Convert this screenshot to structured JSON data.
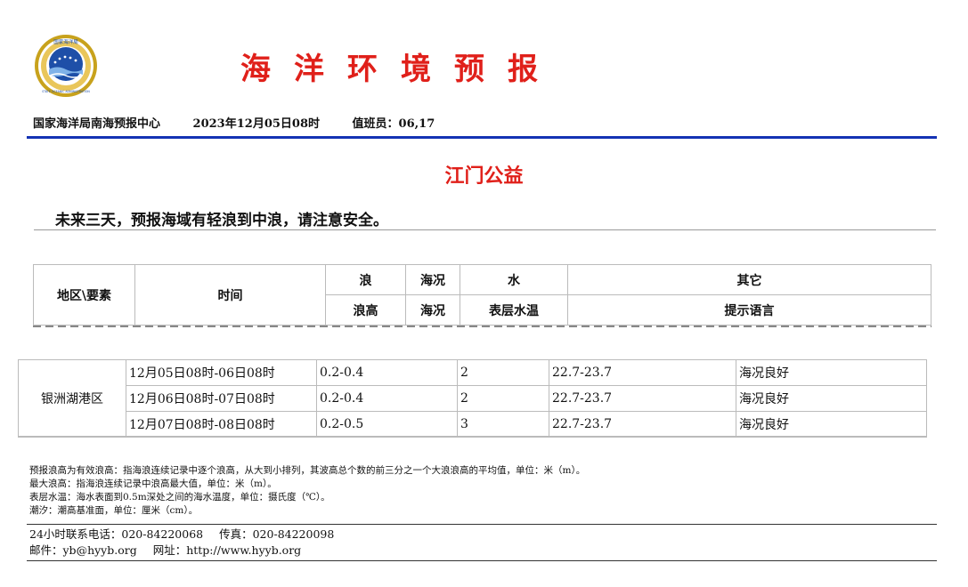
{
  "header": {
    "title": "海洋环境预报",
    "agency": "国家海洋局南海预报中心",
    "datetime": "2023年12月05日08时",
    "duty": "值班员：06,17"
  },
  "logo": {
    "arc_text": "国家海洋局",
    "bottom_text": "STATE OCEANIC ADMINISTRATION"
  },
  "region_title": "江门公益",
  "notice": "未来三天，预报海域有轻浪到中浪，请注意安全。",
  "table_header": {
    "area": "地区\\要素",
    "time": "时间",
    "wave": "浪",
    "sea_state": "海况",
    "water": "水",
    "other": "其它",
    "wave_height": "浪高",
    "sea_state_sub": "海况",
    "surface_temp": "表层水温",
    "tip": "提示语言"
  },
  "table": {
    "location": "银洲湖港区",
    "rows": [
      {
        "time": "12月05日08时-06日08时",
        "wave": "0.2-0.4",
        "state": "2",
        "temp": "22.7-23.7",
        "tip": "海况良好"
      },
      {
        "time": "12月06日08时-07日08时",
        "wave": "0.2-0.4",
        "state": "2",
        "temp": "22.7-23.7",
        "tip": "海况良好"
      },
      {
        "time": "12月07日08时-08日08时",
        "wave": "0.2-0.5",
        "state": "3",
        "temp": "22.7-23.7",
        "tip": "海况良好"
      }
    ]
  },
  "notes": [
    "预报浪高为有效浪高：指海浪连续记录中逐个浪高，从大到小排列，其波高总个数的前三分之一个大浪浪高的平均值，单位：米（m）。",
    "最大浪高：指海浪连续记录中浪高最大值，单位：米（m）。",
    "表层水温：海水表面到0.5m深处之间的海水温度，单位：摄氏度（℃）。",
    "潮汐：潮高基准面，单位：厘米（cm）。"
  ],
  "contact": {
    "phone": "24小时联系电话：020-84220068",
    "fax": "传真：020-84220098",
    "email": "邮件：yb@hyyb.org",
    "website": "网址：http://www.hyyb.org"
  },
  "colors": {
    "title_red": "#e0201a",
    "rule_blue": "#1432b4",
    "logo_blue": "#1e4fa8",
    "logo_gold": "#c8a21c"
  }
}
